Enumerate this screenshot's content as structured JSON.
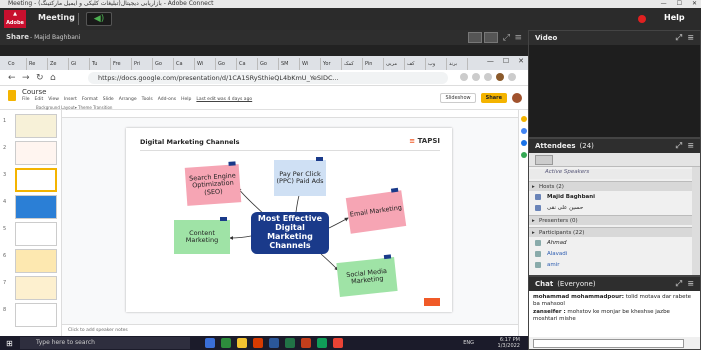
{
  "window": {
    "title": "Meeting - بازاریابی دیجیتال(تبلیغات کلیکی و ایمیل مارکتینگ) - Adobe Connect",
    "controls": [
      "—",
      "☐",
      "✕"
    ]
  },
  "menubar": {
    "logo": "Adobe",
    "meeting": "Meeting",
    "help": "Help"
  },
  "share_pod": {
    "title": "Share",
    "presenter": "- Majid Baghbani"
  },
  "browser": {
    "tabs": [
      "Co",
      "Re",
      "Ze",
      "Gi",
      "Tu",
      "Fre",
      "Pri",
      "Go",
      "Ca",
      "Wi",
      "Go",
      "Ca",
      "Go",
      "SM",
      "Wi",
      "Yor",
      "کمک",
      "Pin",
      "مربی",
      "کف",
      "وب",
      "برند"
    ],
    "url": "https://docs.google.com/presentation/d/1CA1SRySthieQL4bKmU_YeSIDC..."
  },
  "slides_app": {
    "doc_name": "Course",
    "menu": [
      "File",
      "Edit",
      "View",
      "Insert",
      "Format",
      "Slide",
      "Arrange",
      "Tools",
      "Add-ons",
      "Help",
      "Last edit was 4 days ago"
    ],
    "toolbar_text": "Background   Layout▾   Theme   Transition",
    "slideshow": "Slideshow",
    "share": "Share",
    "notes_placeholder": "Click to add speaker notes",
    "slide_numbers": [
      "1",
      "2",
      "3",
      "4",
      "5",
      "6",
      "7",
      "8"
    ]
  },
  "slide": {
    "title": "Digital Marketing Channels",
    "brand": "TAPSI",
    "center": "Most Effective Digital Marketing Channels",
    "notes": [
      {
        "text": "Search Engine Optimization (SEO)",
        "color": "#f6a5b4"
      },
      {
        "text": "Pay Per Click (PPC) Paid Ads",
        "color": "#cfe0f4"
      },
      {
        "text": "Email Marketing",
        "color": "#f6a5b4"
      },
      {
        "text": "Content Marketing",
        "color": "#9fe3a6"
      },
      {
        "text": "Social Media Marketing",
        "color": "#9fe3a6"
      }
    ]
  },
  "taskbar": {
    "search": "Type here to search",
    "lang": "ENG",
    "time": "6:17 PM",
    "date": "1/3/2022"
  },
  "video_pod": {
    "title": "Video"
  },
  "attendees_pod": {
    "title": "Attendees",
    "count": "(24)",
    "active_speakers": "Active Speakers",
    "hosts_label": "Hosts (2)",
    "hosts": [
      "Majid Baghbani",
      "حسین علی نقی"
    ],
    "presenters_label": "Presenters (0)",
    "participants_label": "Participants (22)",
    "participants": [
      "Ahmad",
      "Alavadi",
      "amir"
    ]
  },
  "chat_pod": {
    "title": "Chat",
    "scope": "(Everyone)",
    "messages": [
      {
        "sender": "mohammad mohammadpour:",
        "text": " tolid motava dar rabete ba mahsool"
      },
      {
        "sender": "zanseifer :",
        "text": " mohstov ke monjar be kheshse jazbe moshtari mishe"
      }
    ]
  }
}
